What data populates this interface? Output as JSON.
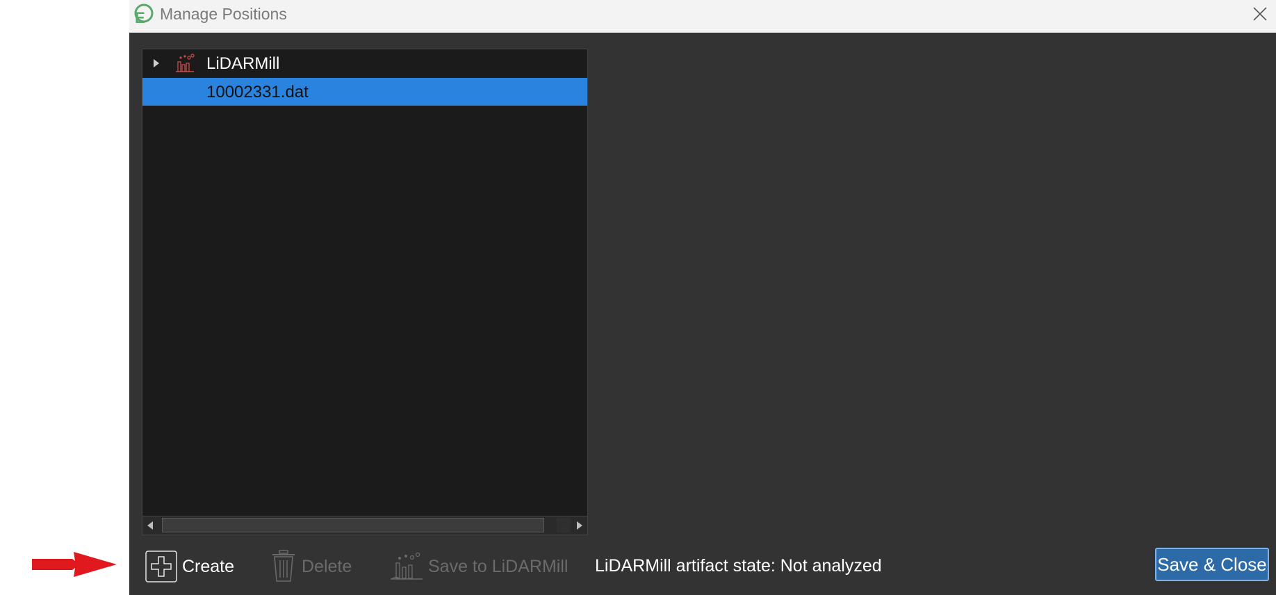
{
  "window": {
    "title": "Manage Positions"
  },
  "tree": {
    "root_label": "LiDARMill",
    "items": [
      {
        "label": "10002331.dat",
        "selected": true
      }
    ]
  },
  "toolbar": {
    "create_label": "Create",
    "delete_label": "Delete",
    "save_lidar_label": "Save to LiDARMill",
    "status_text": "LiDARMill artifact state: Not analyzed",
    "save_close_label": "Save & Close"
  },
  "colors": {
    "selection": "#2a83df",
    "annotation_arrow": "#e0191f",
    "accent_button": "#2d6aa8"
  },
  "icons": [
    "app-logo-icon",
    "close-icon",
    "expand-arrow-icon",
    "lidarmill-icon",
    "plus-icon",
    "trash-icon",
    "lidarmill-save-icon",
    "scroll-left-icon",
    "scroll-right-icon"
  ]
}
